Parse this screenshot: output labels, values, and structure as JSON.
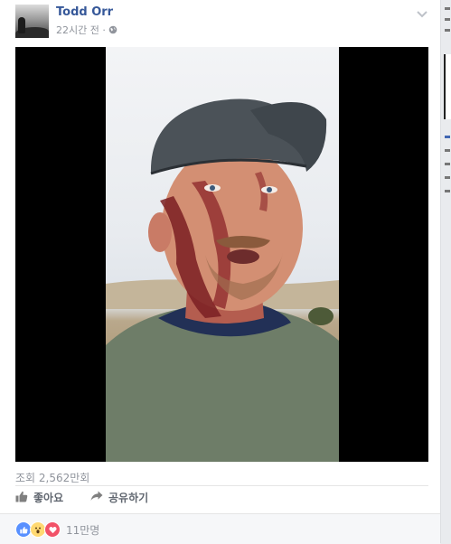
{
  "post": {
    "author": "Todd Orr",
    "timestamp": "22시간 전 ·",
    "audience_icon": "globe-icon"
  },
  "stats": {
    "views": "조회 2,562만회",
    "reaction_count": "11만명",
    "reactions": [
      "like-icon",
      "wow-icon",
      "love-icon"
    ]
  },
  "actions": {
    "like_label": "좋아요",
    "share_label": "공유하기"
  },
  "colors": {
    "link": "#365899",
    "muted": "#90949c",
    "action": "#616770",
    "like": "#5890ff",
    "love": "#f25268"
  }
}
